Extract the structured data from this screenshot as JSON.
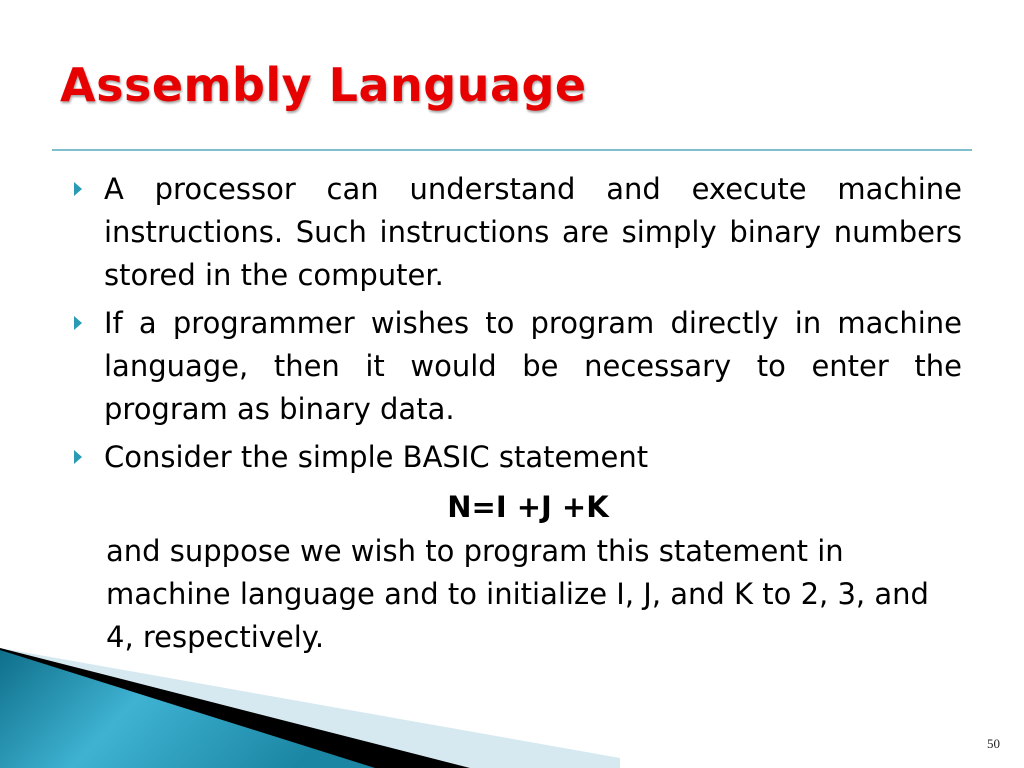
{
  "slide": {
    "title": "Assembly Language",
    "bullets": [
      "A processor can understand and execute machine instructions. Such instructions are simply binary numbers stored in the computer.",
      "If a programmer wishes to program directly in machine language, then it would be necessary to enter the program as binary data.",
      "Consider the simple BASIC statement"
    ],
    "equation": "N=I +J +K",
    "continuation": "and suppose we wish to program this statement in machine language and to initialize I, J, and K to 2, 3, and 4, respectively.",
    "page_number": "50"
  },
  "colors": {
    "title": "#e60000",
    "rule": "#7fbfcc",
    "bullet_marker": "#2a9ab5",
    "decoration_teal": "#1a86a3"
  }
}
